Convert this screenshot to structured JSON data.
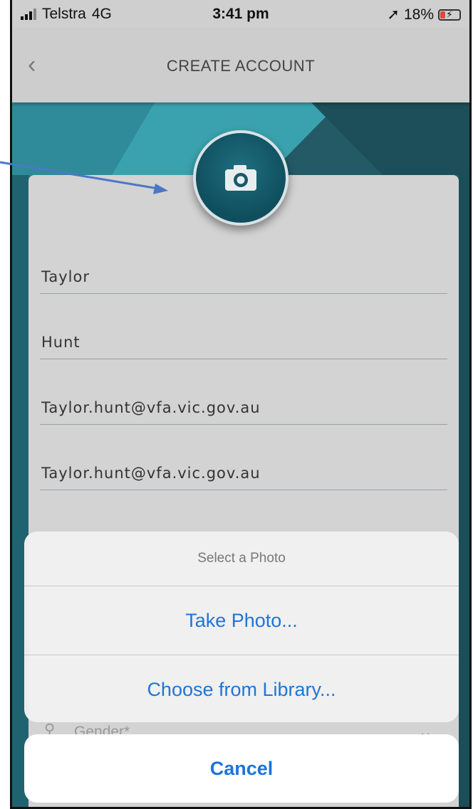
{
  "status_bar": {
    "carrier": "Telstra",
    "network": "4G",
    "time": "3:41 pm",
    "location_icon": "location-arrow-icon",
    "battery_percent": "18%"
  },
  "nav": {
    "back_icon": "chevron-left-icon",
    "title": "CREATE ACCOUNT"
  },
  "profile": {
    "camera_icon": "camera-icon"
  },
  "form": {
    "first_name": "Taylor",
    "last_name": "Hunt",
    "email": "Taylor.hunt@vfa.vic.gov.au",
    "confirm_email": "Taylor.hunt@vfa.vic.gov.au",
    "gender_placeholder": "Gender*"
  },
  "action_sheet": {
    "title": "Select a Photo",
    "take_photo": "Take Photo...",
    "choose_library": "Choose from Library...",
    "cancel": "Cancel"
  },
  "colors": {
    "accent": "#1b74d8",
    "teal": "#0f4e5d"
  }
}
